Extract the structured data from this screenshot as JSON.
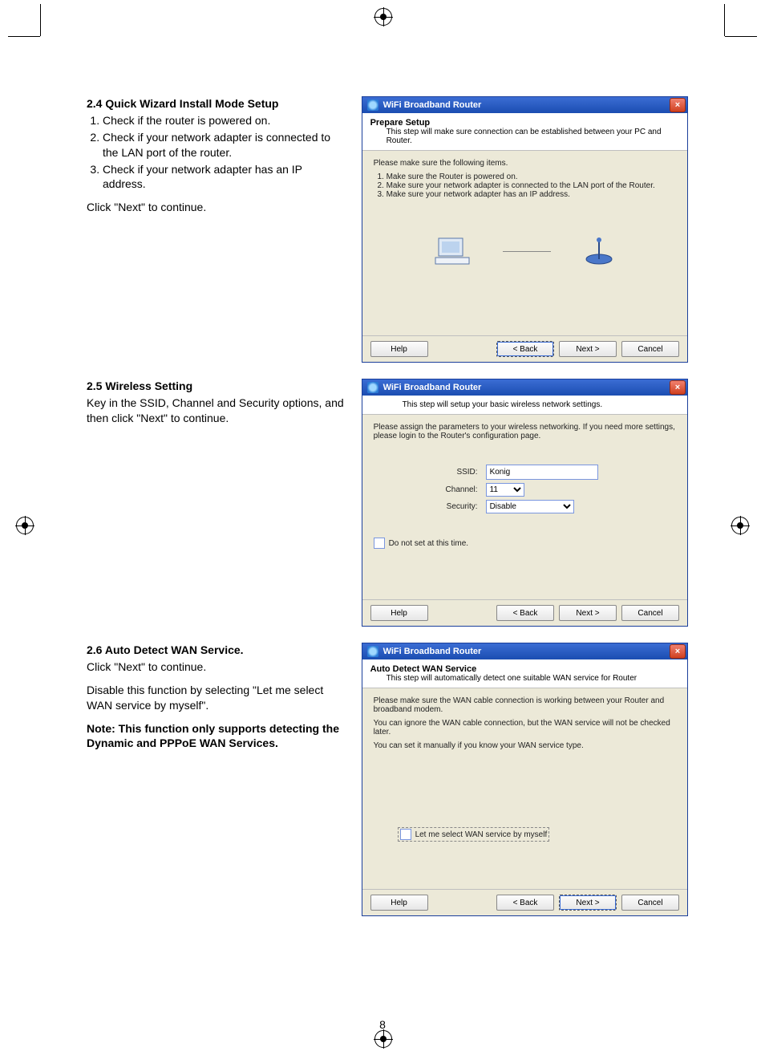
{
  "sections": {
    "s24": {
      "heading": "2.4 Quick Wizard Install Mode Setup",
      "steps": [
        "Check if the router is powered on.",
        "Check if your network adapter is connected to the LAN port of the router.",
        "Check if your network adapter has an IP address."
      ],
      "after": "Click \"Next\" to continue."
    },
    "s25": {
      "heading": "2.5 Wireless Setting",
      "body": "Key in the SSID, Channel and Security options, and then click \"Next\" to continue."
    },
    "s26": {
      "heading": "2.6 Auto Detect WAN Service.",
      "p1": "Click \"Next\" to continue.",
      "p2": "Disable this function by selecting \"Let me select WAN service by myself\".",
      "note": "Note: This function only supports detecting the Dynamic and PPPoE WAN Services."
    }
  },
  "window_common": {
    "title": "WiFi Broadband Router",
    "help": "Help",
    "back": "< Back",
    "next": "Next >",
    "cancel": "Cancel"
  },
  "win1": {
    "hdr_title": "Prepare Setup",
    "hdr_sub": "This step will make sure connection can be established between your PC and Router.",
    "body_intro": "Please make sure the following items.",
    "items": [
      "Make sure the Router is powered on.",
      "Make sure your network adapter is connected to the LAN port of the Router.",
      "Make sure your network adapter has an IP address."
    ]
  },
  "win2": {
    "hdr_sub": "This step will setup your basic wireless network settings.",
    "body_intro": "Please assign the parameters to your wireless networking. If you need more settings, please login to the Router's configuration page.",
    "labels": {
      "ssid": "SSID:",
      "channel": "Channel:",
      "security": "Security:"
    },
    "values": {
      "ssid": "Konig",
      "channel": "11",
      "security": "Disable"
    },
    "checkbox": "Do not set at this time."
  },
  "win3": {
    "hdr_title": "Auto Detect WAN Service",
    "hdr_sub": "This step will automatically detect one suitable WAN service for Router",
    "p1": "Please make sure the WAN cable connection is working between your Router and broadband modem.",
    "p2": "You can ignore the WAN cable connection, but the WAN service will not be checked later.",
    "p3": "You can set it manually if you know your WAN service type.",
    "checkbox": "Let me select WAN service by myself"
  },
  "page_number": "8"
}
